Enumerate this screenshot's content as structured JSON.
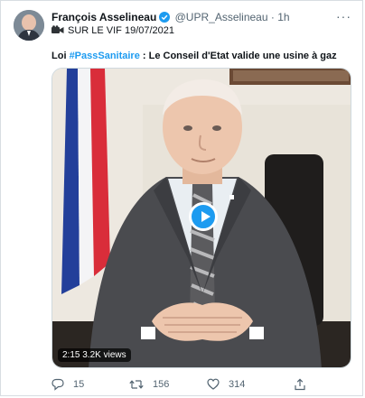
{
  "tweet": {
    "author_name": "François Asselineau",
    "handle": "@UPR_Asselineau",
    "separator": "·",
    "time": "1h",
    "more": "···",
    "live_line": "SUR LE VIF 19/07/2021",
    "text_prefix": "Loi ",
    "hashtag": "#PassSanitaire",
    "text_rest": " : Le Conseil d'Etat valide une usine à gaz"
  },
  "video": {
    "duration": "2:15",
    "views": "3.2K views"
  },
  "actions": {
    "replies": "15",
    "retweets": "156",
    "likes": "314"
  },
  "colors": {
    "accent": "#1d9bf0",
    "text": "#0f1419",
    "muted": "#536471"
  },
  "icons": [
    "verified-badge-icon",
    "camera-icon",
    "more-icon",
    "play-icon",
    "reply-icon",
    "retweet-icon",
    "like-icon",
    "share-icon"
  ]
}
